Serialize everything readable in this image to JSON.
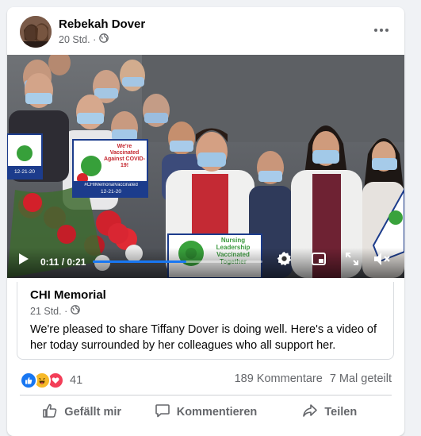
{
  "post": {
    "author": "Rebekah Dover",
    "time": "20 Std. ·",
    "privacy_icon": "globe-icon",
    "more_icon": "more-horizontal-icon"
  },
  "video": {
    "current_time": "0:11",
    "separator": " / ",
    "duration": "0:21",
    "progress_fraction": 0.55,
    "signs": {
      "left_sign": "We're Vaccinated Against COVID-19!",
      "left_hashtag": "#CHIMemorialVaccinated",
      "left_date": "12-21-20",
      "center_sign": "Nursing Leadership Vaccinated Together",
      "far_left_date": "12-21-20"
    }
  },
  "shared": {
    "page_name": "CHI Memorial",
    "time": "21 Std. ·",
    "text": "We're pleased to share Tiffany Dover is doing well. Here's a video of her today surrounded by her colleagues who all support her."
  },
  "engagement": {
    "reactions_count": "41",
    "comments": "189 Kommentare",
    "shares": "7 Mal geteilt"
  },
  "actions": {
    "like": "Gefällt mir",
    "comment": "Kommentieren",
    "share": "Teilen"
  },
  "colors": {
    "like_blue": "#1877f2",
    "haha_yellow": "#f7b928",
    "love_red": "#f33e58"
  }
}
